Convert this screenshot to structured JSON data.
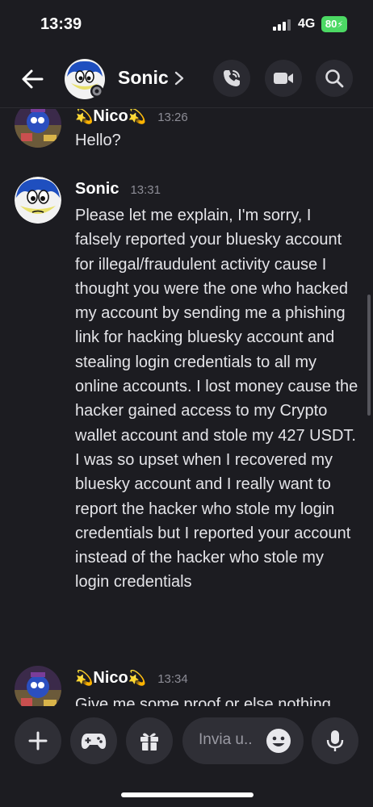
{
  "status_bar": {
    "time": "13:39",
    "network": "4G",
    "battery": "80"
  },
  "header": {
    "title": "Sonic",
    "icons": [
      "back-arrow-icon",
      "chevron-right-icon",
      "voice-call-icon",
      "video-call-icon",
      "search-icon"
    ]
  },
  "messages": [
    {
      "author": "Nico",
      "author_decoration": "💫",
      "time": "13:26",
      "text": "Hello?"
    },
    {
      "author": "Sonic",
      "time": "13:31",
      "text": "Please let me explain, I'm sorry, I falsely reported your bluesky account for illegal/fraudulent activity cause I thought you were the one who hacked my account by sending me a phishing link for hacking bluesky  account and stealing login credentials to all my online accounts. I lost money cause the hacker gained access to my Crypto wallet account and stole my 427 USDT. I was so upset when I recovered my bluesky  account and I really want to report the hacker who stole my login credentials but I reported your account instead of the hacker who stole my login credentials"
    },
    {
      "author": "Nico",
      "author_decoration": "💫",
      "time": "13:34",
      "text": "Give me some proof or else nothing"
    }
  ],
  "composer": {
    "placeholder": "Invia u..",
    "icons": [
      "plus-icon",
      "gamepad-icon",
      "gift-icon",
      "emoji-icon",
      "microphone-icon"
    ]
  },
  "colors": {
    "background": "#1c1c21",
    "button_bg": "#2f2f36",
    "battery_green": "#4cd964",
    "timestamp": "#8d8d96"
  }
}
